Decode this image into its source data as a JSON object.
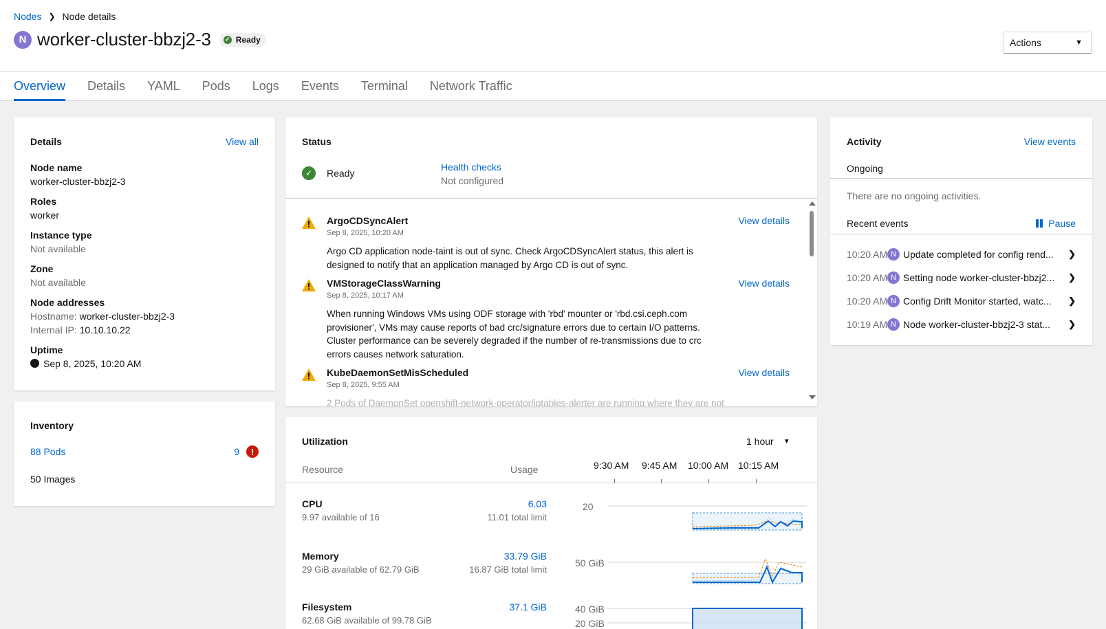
{
  "breadcrumb": {
    "parent": "Nodes",
    "current": "Node details"
  },
  "header": {
    "badge": "N",
    "title": "worker-cluster-bbzj2-3",
    "status": "Ready",
    "actions_label": "Actions"
  },
  "tabs": [
    "Overview",
    "Details",
    "YAML",
    "Pods",
    "Logs",
    "Events",
    "Terminal",
    "Network Traffic"
  ],
  "details": {
    "title": "Details",
    "view_all": "View all",
    "node_name_label": "Node name",
    "node_name": "worker-cluster-bbzj2-3",
    "roles_label": "Roles",
    "roles": "worker",
    "instance_type_label": "Instance type",
    "instance_type": "Not available",
    "zone_label": "Zone",
    "zone": "Not available",
    "addresses_label": "Node addresses",
    "hostname_key": "Hostname:",
    "hostname": "worker-cluster-bbzj2-3",
    "internal_ip_key": "Internal IP:",
    "internal_ip": "10.10.10.22",
    "uptime_label": "Uptime",
    "uptime": "Sep 8, 2025, 10:20 AM"
  },
  "inventory": {
    "title": "Inventory",
    "pods": "88 Pods",
    "pod_errors": "9",
    "images": "50 Images"
  },
  "status": {
    "title": "Status",
    "state": "Ready",
    "health_checks": "Health checks",
    "health_status": "Not configured",
    "alerts": [
      {
        "name": "ArgoCDSyncAlert",
        "time": "Sep 8, 2025, 10:20 AM",
        "link": "View details",
        "desc": "Argo CD application node-taint is out of sync. Check ArgoCDSyncAlert status, this alert is designed to notify that an application managed by Argo CD is out of sync."
      },
      {
        "name": "VMStorageClassWarning",
        "time": "Sep 8, 2025, 10:17 AM",
        "link": "View details",
        "desc": "When running Windows VMs using ODF storage with 'rbd' mounter or 'rbd.csi.ceph.com provisioner', VMs may cause reports of bad crc/signature errors due to certain I/O patterns. Cluster performance can be severely degraded if the number of re-transmissions due to crc errors causes network saturation."
      },
      {
        "name": "KubeDaemonSetMisScheduled",
        "time": "Sep 8, 2025, 9:55 AM",
        "link": "View details",
        "desc": "2 Pods of DaemonSet openshift-network-operator/iptables-alerter are running where they are not"
      }
    ]
  },
  "utilization": {
    "title": "Utilization",
    "range": "1 hour",
    "col_resource": "Resource",
    "col_usage": "Usage",
    "times": [
      "9:30 AM",
      "9:45 AM",
      "10:00 AM",
      "10:15 AM"
    ],
    "resources": [
      {
        "name": "CPU",
        "available": "9.97 available of 16",
        "value": "6.03",
        "limit": "11.01 total limit",
        "axis_label": "20"
      },
      {
        "name": "Memory",
        "available": "29 GiB available of 62.79 GiB",
        "value": "33.79 GiB",
        "limit": "16.87 GiB total limit",
        "axis_label": "50 GiB"
      },
      {
        "name": "Filesystem",
        "available": "62.68 GiB available of 99.78 GiB",
        "value": "37.1 GiB",
        "limit": "",
        "axis_label": "40 GiB",
        "axis_label2": "20 GiB"
      }
    ]
  },
  "activity": {
    "title": "Activity",
    "view_events": "View events",
    "ongoing": "Ongoing",
    "no_ongoing": "There are no ongoing activities.",
    "recent": "Recent events",
    "pause": "Pause",
    "events": [
      {
        "time": "10:20 AM",
        "badge": "N",
        "msg": "Update completed for config rend..."
      },
      {
        "time": "10:20 AM",
        "badge": "N",
        "msg": "Setting node worker-cluster-bbzj2..."
      },
      {
        "time": "10:20 AM",
        "badge": "N",
        "msg": "Config Drift Monitor started, watc..."
      },
      {
        "time": "10:19 AM",
        "badge": "N",
        "msg": "Node worker-cluster-bbzj2-3 stat..."
      }
    ]
  },
  "colors": {
    "link": "#0066cc",
    "ok": "#3e8635",
    "warning": "#f0ab00",
    "danger": "#c9190b",
    "node_badge": "#8476d1",
    "chart_line": "#0066cc",
    "chart_limit": "#ec7a08"
  }
}
